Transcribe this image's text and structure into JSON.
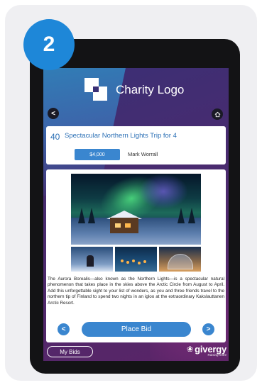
{
  "step": {
    "number": "2"
  },
  "header": {
    "logo_text": "Charity Logo",
    "back_icon": "chevron-left-icon",
    "home_icon": "home-icon"
  },
  "lot": {
    "number": "40",
    "title": "Spectacular Northern Lights Trip for 4",
    "current_bid": "$4,000",
    "bidder": "Mark Worrall"
  },
  "description": "The Aurora Borealis—also known as the Northern Lights—is a spectacular natural phenomenon that takes place in the skies above the Arctic Circle from August to April. Add this unforgettable sight to your list of wonders, as you and three friends travel to the northern tip of Finland to spend two nights in an igloo at the extraordinary Kakslauttanen Arctic Resort.",
  "actions": {
    "prev_icon": "chevron-left-icon",
    "next_icon": "chevron-right-icon",
    "place_bid_label": "Place Bid"
  },
  "footer": {
    "my_bids_label": "My Bids",
    "brand_name": "givergy",
    "brand_tagline": "Raising more"
  },
  "colors": {
    "accent": "#1e87d8",
    "button": "#3a86cf",
    "screen_bg": "#4a2b6f"
  }
}
